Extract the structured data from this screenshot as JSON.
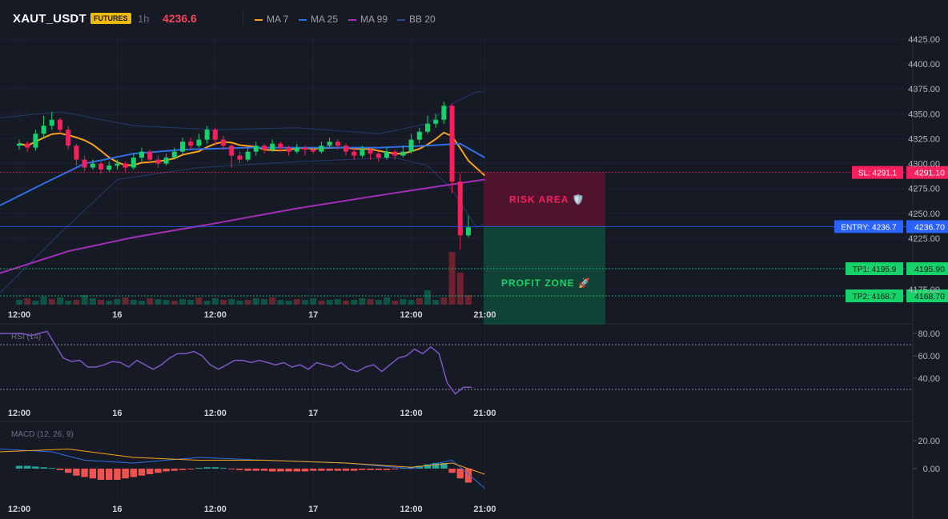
{
  "header": {
    "symbol": "XAUT_USDT",
    "badge": "FUTURES",
    "timeframe": "1h",
    "last_price": "4236.6",
    "legend": [
      {
        "label": "MA 7",
        "color": "#f7a21b"
      },
      {
        "label": "MA 25",
        "color": "#2f6fe4"
      },
      {
        "label": "MA 99",
        "color": "#a32eb8"
      },
      {
        "label": "BB 20",
        "color": "#2a4a8f"
      }
    ]
  },
  "price_axis": {
    "ticks": [
      "4425.00",
      "4400.00",
      "4375.00",
      "4350.00",
      "4325.00",
      "4300.00",
      "4275.00",
      "4250.00",
      "4225.00",
      "4175.00"
    ],
    "values": [
      4425,
      4400,
      4375,
      4350,
      4325,
      4300,
      4275,
      4250,
      4225,
      4175
    ]
  },
  "time_axis": {
    "ticks": [
      "12:00",
      "16",
      "12:00",
      "17",
      "12:00",
      "21:00"
    ],
    "values": [
      0,
      12,
      24,
      36,
      48,
      57
    ]
  },
  "levels": {
    "sl": {
      "tag": "SL: 4291.1",
      "price_label": "4291.10",
      "value": 4291.1,
      "color": "#f6215c"
    },
    "entry": {
      "tag": "ENTRY: 4236.7",
      "price_label": "4236.70",
      "value": 4236.7,
      "color": "#2962ff"
    },
    "tp1": {
      "tag": "TP1: 4195.9",
      "price_label": "4195.90",
      "value": 4195.9,
      "color": "#16d26b"
    },
    "tp2": {
      "tag": "TP2: 4168.7",
      "price_label": "4168.70",
      "value": 4168.7,
      "color": "#16d26b"
    }
  },
  "zones": {
    "risk_label": "RISK AREA 🛡️",
    "profit_label": "PROFIT ZONE 🚀"
  },
  "rsi": {
    "title": "RSI (14)",
    "ticks": [
      "80.00",
      "60.00",
      "40.00"
    ],
    "tick_values": [
      80,
      60,
      40
    ],
    "overbought": 70,
    "oversold": 30,
    "color": "#7e57c2"
  },
  "macd": {
    "title": "MACD (12, 26, 9)",
    "ticks": [
      "20.00",
      "0.00"
    ],
    "tick_values": [
      20,
      0
    ]
  }
}
